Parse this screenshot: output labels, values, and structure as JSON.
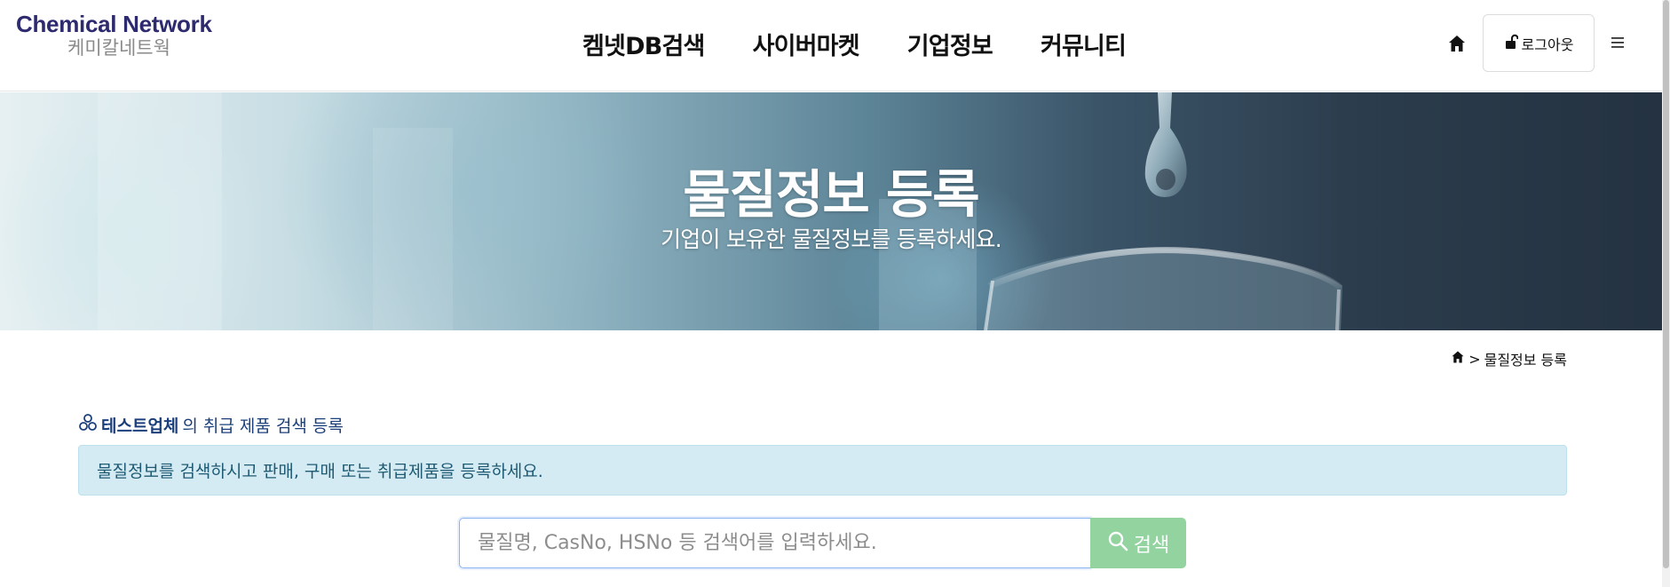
{
  "header": {
    "logo_en": "Chemical Network",
    "logo_ko": "케미칼네트웍",
    "nav": [
      "켐넷DB검색",
      "사이버마켓",
      "기업정보",
      "커뮤니티"
    ],
    "logout_label": "로그아웃"
  },
  "hero": {
    "title": "물질정보 등록",
    "subtitle": "기업이 보유한 물질정보를 등록하세요."
  },
  "breadcrumb": {
    "separator": ">",
    "current": "물질정보 등록"
  },
  "section": {
    "company": "테스트업체",
    "title_rest": "의 취급 제품 검색 등록",
    "info": "물질정보를 검색하시고 판매, 구매 또는 취급제품을 등록하세요."
  },
  "search": {
    "placeholder": "물질명, CasNo, HSNo 등 검색어를 입력하세요.",
    "value": "",
    "button_label": "검색"
  },
  "colors": {
    "brand": "#2d2a6e",
    "section_title": "#1b3f7a",
    "info_bg": "#d5ebf3",
    "search_button": "#92d3a0"
  },
  "icons": {
    "home": "home-icon",
    "lock": "unlock-icon",
    "menu": "hamburger-icon",
    "section": "molecule-icon",
    "search": "search-icon"
  }
}
